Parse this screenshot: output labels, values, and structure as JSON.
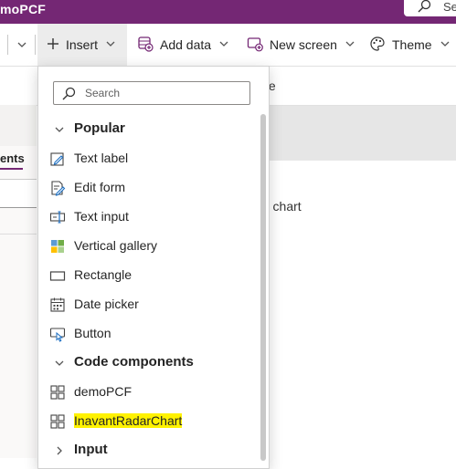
{
  "app": {
    "title": "moPCF"
  },
  "top_search": {
    "label": "Se"
  },
  "commandbar": {
    "insert": "Insert",
    "add_data": "Add data",
    "new_screen": "New screen",
    "theme": "Theme"
  },
  "background": {
    "formula_fragment": "te",
    "tree_tab": "ents",
    "canvas_label": "r chart"
  },
  "dropdown": {
    "search_placeholder": "Search",
    "sections": [
      {
        "label": "Popular",
        "items": [
          {
            "label": "Text label",
            "icon": "text-label-icon"
          },
          {
            "label": "Edit form",
            "icon": "edit-form-icon"
          },
          {
            "label": "Text input",
            "icon": "text-input-icon"
          },
          {
            "label": "Vertical gallery",
            "icon": "gallery-icon"
          },
          {
            "label": "Rectangle",
            "icon": "rectangle-icon"
          },
          {
            "label": "Date picker",
            "icon": "calendar-icon"
          },
          {
            "label": "Button",
            "icon": "button-icon"
          }
        ]
      },
      {
        "label": "Code components",
        "items": [
          {
            "label": "demoPCF",
            "icon": "code-component-icon"
          },
          {
            "label": "InavantRadarChart",
            "icon": "code-component-icon",
            "highlight_color": "#fff200"
          }
        ]
      },
      {
        "label": "Input",
        "items": []
      }
    ]
  },
  "colors": {
    "brand": "#742774",
    "highlight": "#fff200"
  }
}
